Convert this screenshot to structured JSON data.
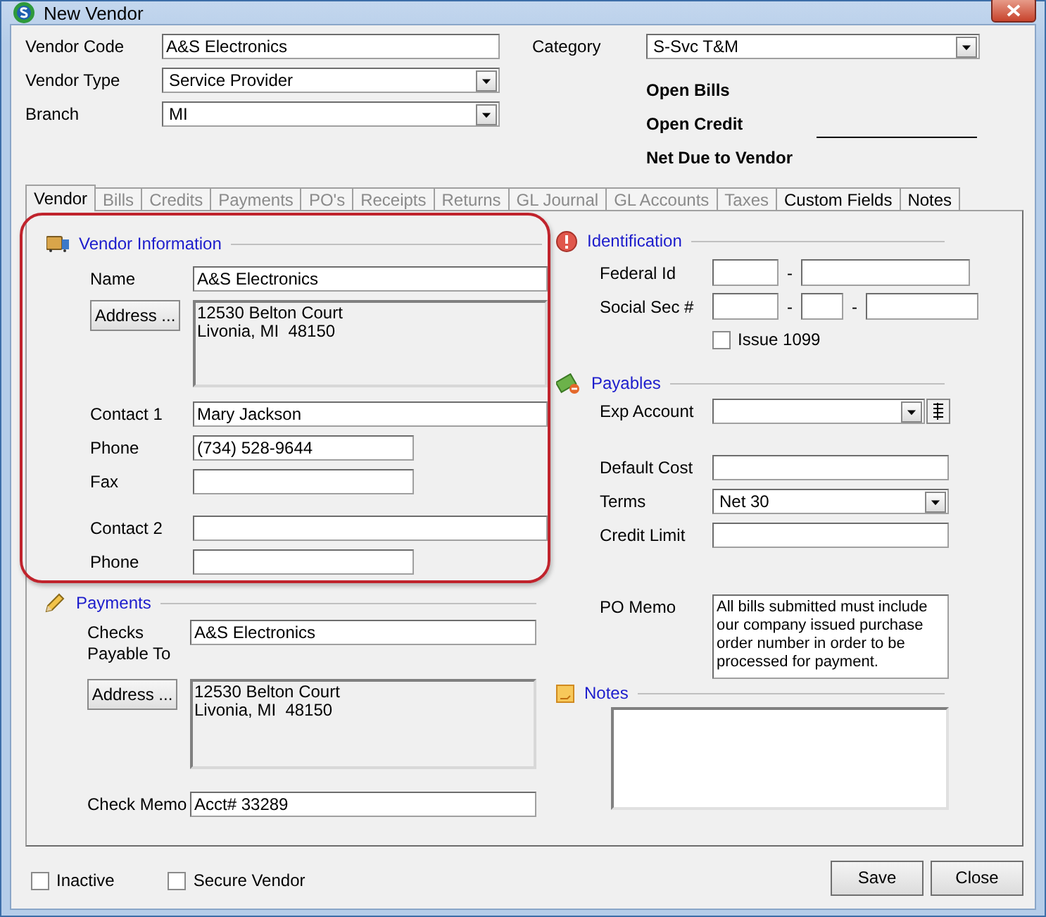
{
  "window": {
    "title": "New Vendor"
  },
  "header": {
    "fields": [
      {
        "label": "Vendor Code",
        "value": "A&S Electronics",
        "kind": "text"
      },
      {
        "label": "Vendor Type",
        "value": "Service Provider",
        "kind": "dropdown"
      },
      {
        "label": "Branch",
        "value": "MI",
        "kind": "dropdown"
      }
    ],
    "category": {
      "label": "Category",
      "value": "S-Svc T&M"
    },
    "totals": [
      {
        "label": "Open Bills",
        "kind": "plain"
      },
      {
        "label": "Open Credit",
        "kind": "plain"
      },
      {
        "label": "Net Due to Vendor",
        "kind": "total"
      }
    ]
  },
  "tabs": [
    {
      "label": "Vendor",
      "selected": true,
      "disabled": false
    },
    {
      "label": "Bills",
      "selected": false,
      "disabled": true
    },
    {
      "label": "Credits",
      "selected": false,
      "disabled": true
    },
    {
      "label": "Payments",
      "selected": false,
      "disabled": true
    },
    {
      "label": "PO's",
      "selected": false,
      "disabled": true
    },
    {
      "label": "Receipts",
      "selected": false,
      "disabled": true
    },
    {
      "label": "Returns",
      "selected": false,
      "disabled": true
    },
    {
      "label": "GL Journal",
      "selected": false,
      "disabled": true
    },
    {
      "label": "GL Accounts",
      "selected": false,
      "disabled": true
    },
    {
      "label": "Taxes",
      "selected": false,
      "disabled": true
    },
    {
      "label": "Custom Fields",
      "selected": false,
      "disabled": false
    },
    {
      "label": "Notes",
      "selected": false,
      "disabled": false
    }
  ],
  "vendor_information": {
    "title": "Vendor Information",
    "name": {
      "label": "Name",
      "value": "A&S Electronics"
    },
    "address": {
      "button": "Address ...",
      "lines": [
        "12530 Belton Court",
        "Livonia, MI  48150"
      ]
    },
    "contact_groups": [
      [
        {
          "label": "Contact 1",
          "value": "Mary Jackson",
          "kind": "wide"
        },
        {
          "label": "Phone",
          "value": "(734) 528-9644",
          "kind": "short"
        },
        {
          "label": "Fax",
          "kind": "short"
        }
      ],
      [
        {
          "label": "Contact 2",
          "kind": "wide"
        },
        {
          "label": "Phone",
          "kind": "short"
        }
      ]
    ]
  },
  "payments": {
    "title": "Payments",
    "checks_payable": {
      "label": "Checks Payable To",
      "value": "A&S Electronics"
    },
    "address": {
      "button": "Address ...",
      "lines": [
        "12530 Belton Court",
        "Livonia, MI  48150"
      ]
    },
    "check_memo": {
      "label": "Check Memo",
      "value": "Acct# 33289"
    }
  },
  "identification": {
    "title": "Identification",
    "rows": [
      {
        "label": "Federal Id",
        "kind": "federal",
        "separators": [
          "-"
        ]
      },
      {
        "label": "Social Sec #",
        "kind": "ssn",
        "separators": [
          "-",
          "-"
        ]
      }
    ],
    "issue_1099": {
      "label": "Issue 1099",
      "checked": false
    }
  },
  "payables": {
    "title": "Payables",
    "groups": [
      [
        {
          "label": "Exp Account",
          "kind": "lookup"
        }
      ],
      [
        {
          "label": "Default Cost",
          "kind": "text"
        },
        {
          "label": "Terms",
          "value": "Net 30",
          "kind": "dropdown"
        },
        {
          "label": "Credit Limit",
          "kind": "text"
        }
      ]
    ],
    "po_memo": {
      "label": "PO Memo",
      "value": "All bills submitted must include our company issued purchase order number in order to be processed for payment."
    }
  },
  "notes": {
    "title": "Notes"
  },
  "footer": {
    "checkboxes": [
      {
        "label": "Inactive",
        "checked": false
      },
      {
        "label": "Secure Vendor",
        "checked": false
      }
    ],
    "buttons": [
      "Save",
      "Close"
    ]
  }
}
